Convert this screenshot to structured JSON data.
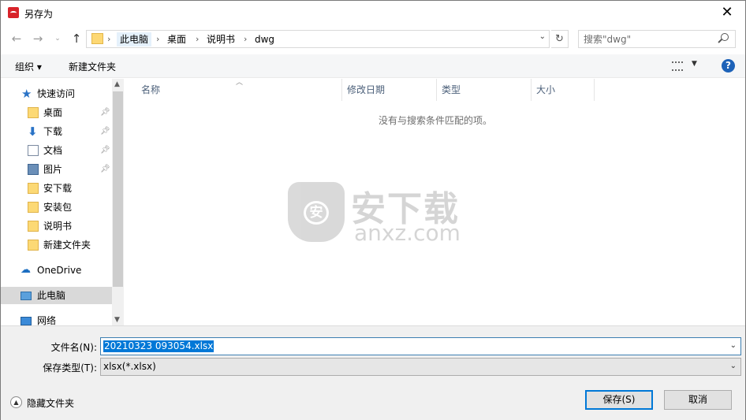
{
  "window": {
    "title": "另存为",
    "close": "✕"
  },
  "address": {
    "crumbs": [
      "此电脑",
      "桌面",
      "说明书",
      "dwg"
    ],
    "refresh": "↻"
  },
  "search": {
    "placeholder": "搜索\"dwg\""
  },
  "toolbar": {
    "organize": "组织 ▾",
    "new_folder": "新建文件夹",
    "help": "?"
  },
  "sidebar": {
    "quick_access": "快速访问",
    "items": [
      {
        "label": "桌面",
        "icon": "folder-icon",
        "pinned": true
      },
      {
        "label": "下载",
        "icon": "download-icon",
        "pinned": true
      },
      {
        "label": "文档",
        "icon": "document-icon",
        "pinned": true
      },
      {
        "label": "图片",
        "icon": "picture-icon",
        "pinned": true
      },
      {
        "label": "安下载",
        "icon": "folder-icon",
        "pinned": false
      },
      {
        "label": "安装包",
        "icon": "folder-icon",
        "pinned": false
      },
      {
        "label": "说明书",
        "icon": "folder-icon",
        "pinned": false
      },
      {
        "label": "新建文件夹",
        "icon": "folder-icon",
        "pinned": false
      }
    ],
    "onedrive": "OneDrive",
    "this_pc": "此电脑",
    "network": "网络"
  },
  "columns": [
    "名称",
    "修改日期",
    "类型",
    "大小"
  ],
  "empty_message": "没有与搜索条件匹配的项。",
  "watermark": {
    "cn": "安下载",
    "en": "anxz.com",
    "shield_char": "安"
  },
  "form": {
    "filename_label": "文件名(N):",
    "filename_value": "20210323 093054.xlsx",
    "filetype_label": "保存类型(T):",
    "filetype_value": "xlsx(*.xlsx)"
  },
  "footer": {
    "hide_folders": "隐藏文件夹",
    "save": "保存(S)",
    "cancel": "取消"
  },
  "colors": {
    "accent": "#0078d7",
    "help": "#1d62b8",
    "folder": "#fcd975"
  }
}
